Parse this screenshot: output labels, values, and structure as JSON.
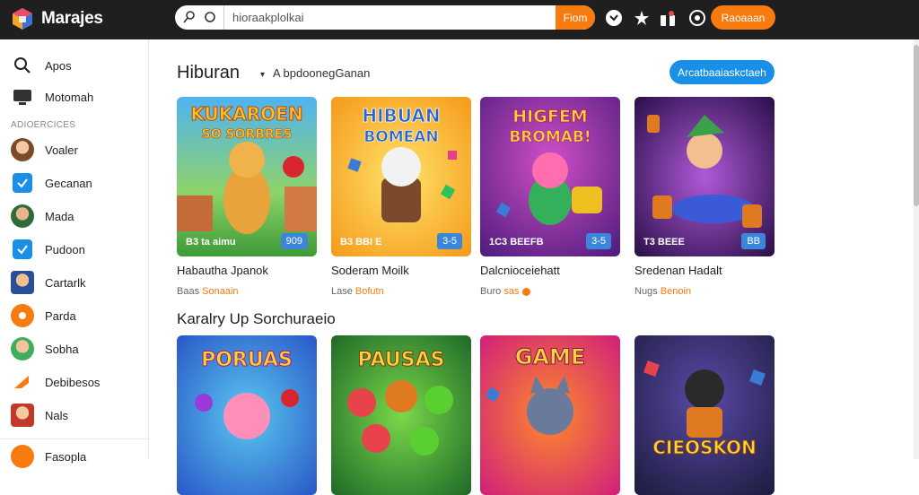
{
  "app": {
    "title": "Marajes"
  },
  "search": {
    "placeholder": "",
    "value": "hioraakplolkai",
    "button_label": "Fiom"
  },
  "header": {
    "cta_label": "Raoaaan"
  },
  "sidebar": {
    "top_items": [
      {
        "label": "Apos",
        "icon": "search-icon"
      },
      {
        "label": "Motomah",
        "icon": "monitor-icon"
      }
    ],
    "section_label": "ADIOERCICES",
    "items": [
      {
        "label": "Voaler",
        "icon": "avatar"
      },
      {
        "label": "Gecanan",
        "icon": "check-icon"
      },
      {
        "label": "Mada",
        "icon": "avatar"
      },
      {
        "label": "Pudoon",
        "icon": "check-icon"
      },
      {
        "label": "Cartarlk",
        "icon": "avatar"
      },
      {
        "label": "Parda",
        "icon": "game-icon"
      },
      {
        "label": "Sobha",
        "icon": "avatar"
      },
      {
        "label": "Debibesos",
        "icon": "arrow-icon"
      },
      {
        "label": "Nals",
        "icon": "avatar"
      },
      {
        "label": "Fasopla",
        "icon": "game-icon"
      }
    ]
  },
  "main": {
    "section1": {
      "title": "Hiburan",
      "sort_label": "A bpdoonegGanan",
      "cta_label": "Arcatbaaiaskctaeh",
      "games": [
        {
          "title": "Habautha Jpanok",
          "meta_gray": "Baas",
          "meta_accent": "Sonaain",
          "badge_left": "B3 ta aimu",
          "badge_right": "909",
          "thumb_text_1": "KUKAROEN",
          "thumb_text_2": "SO SORBRES"
        },
        {
          "title": "Soderam Moilk",
          "meta_gray": "Lase",
          "meta_accent": "Bofutn",
          "badge_left": "B3 BBI E",
          "badge_right": "3-5",
          "thumb_text_1": "HIBUAN",
          "thumb_text_2": "BOMEAN"
        },
        {
          "title": "Dalcnioceiehatt",
          "meta_gray": "Buro",
          "meta_accent": "sas",
          "badge_left": "1C3 BEEFB",
          "badge_right": "3-5",
          "thumb_text_1": "HIGFEM",
          "thumb_text_2": "BROMAB!"
        },
        {
          "title": "Sredenan Hadalt",
          "meta_gray": "Nugs",
          "meta_accent": "Benoin",
          "badge_left": "T3 BEEE",
          "badge_right": "BB",
          "thumb_text_1": "",
          "thumb_text_2": ""
        }
      ]
    },
    "section2": {
      "title": "Karalry Up Sorchuraeio",
      "games": [
        {
          "thumb_text_1": "PORUAS"
        },
        {
          "thumb_text_1": "PAUSAS"
        },
        {
          "thumb_text_1": "GAME"
        },
        {
          "thumb_text_1": "CIEOSKON"
        }
      ]
    }
  },
  "colors": {
    "topbar": "#1f1f1f",
    "accent_orange": "#f77b0f",
    "accent_blue": "#1a8fe8"
  }
}
